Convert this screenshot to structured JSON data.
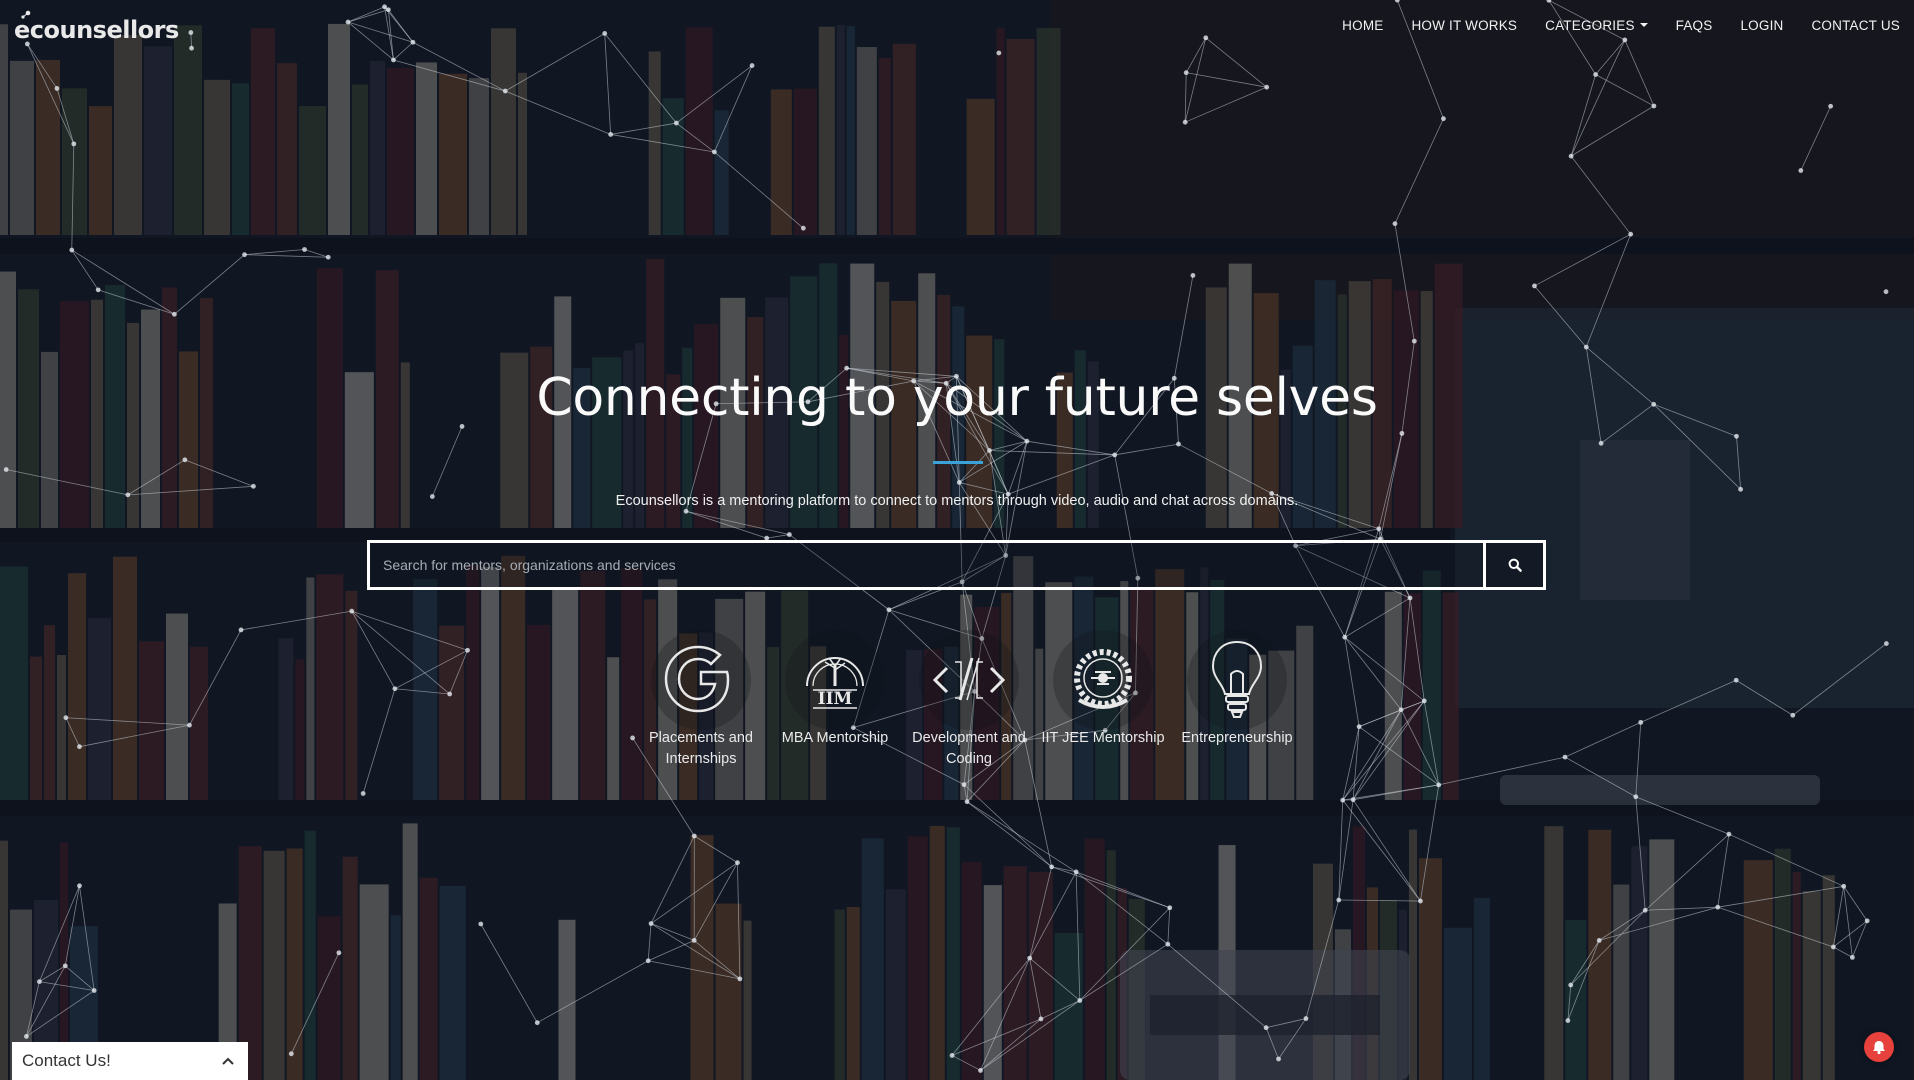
{
  "brand": {
    "logo_text": "ecounsellors"
  },
  "nav": {
    "items": [
      {
        "label": "HOME"
      },
      {
        "label": "HOW IT WORKS"
      },
      {
        "label": "CATEGORIES",
        "dropdown": true
      },
      {
        "label": "FAQS"
      },
      {
        "label": "LOGIN"
      },
      {
        "label": "CONTACT US"
      }
    ]
  },
  "hero": {
    "title": "Connecting to your future selves",
    "subtitle": "Ecounsellors is a mentoring platform to connect to mentors through video, audio and chat across domains.",
    "accent_color": "#3aa2d6"
  },
  "search": {
    "placeholder": "Search for mentors, organizations and services",
    "value": "",
    "button_icon": "search-icon"
  },
  "categories": [
    {
      "label": "Placements and Internships",
      "icon": "google-g-icon"
    },
    {
      "label": "MBA Mentorship",
      "icon": "iim-logo-icon"
    },
    {
      "label": "Development and Coding",
      "icon": "code-icon"
    },
    {
      "label": "IIT JEE Mentorship",
      "icon": "iit-emblem-icon"
    },
    {
      "label": "Entrepreneurship",
      "icon": "lightbulb-icon"
    }
  ],
  "contact_widget": {
    "label": "Contact Us!",
    "icon": "chevron-up-icon"
  },
  "notification": {
    "icon": "bell-icon",
    "color": "#e6413c"
  }
}
